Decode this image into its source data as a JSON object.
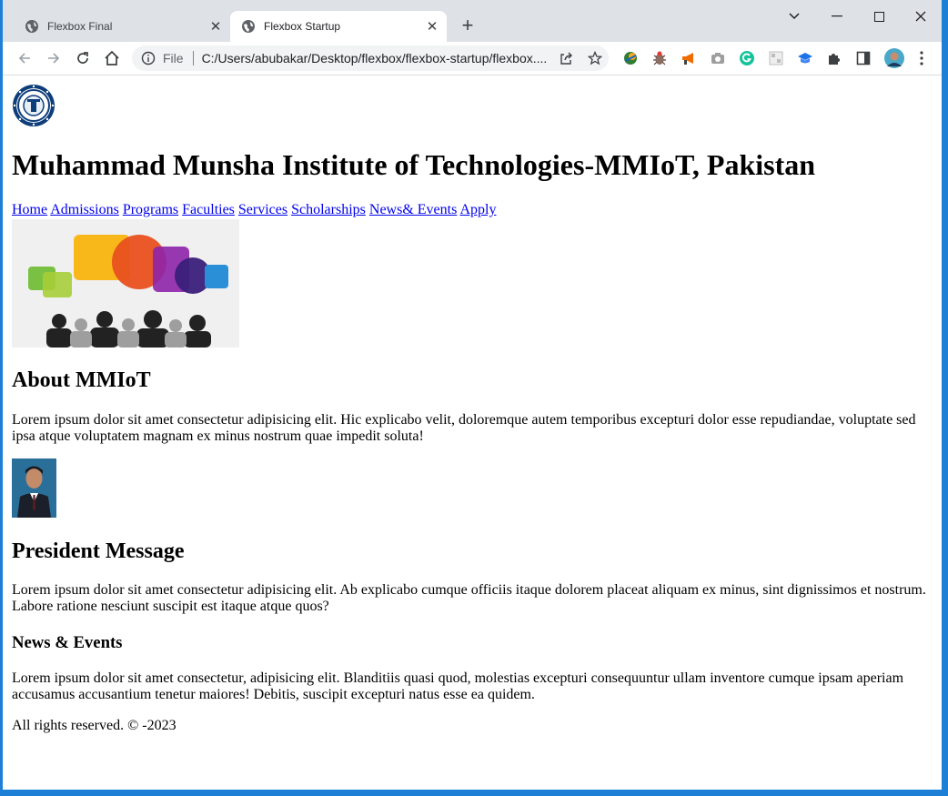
{
  "browser": {
    "tabs": [
      {
        "title": "Flexbox Final",
        "active": false
      },
      {
        "title": "Flexbox Startup",
        "active": true
      }
    ],
    "omnibox": {
      "scheme_label": "File",
      "url": "C:/Users/abubakar/Desktop/flexbox/flexbox-startup/flexbox...."
    },
    "icons": [
      "back-icon",
      "forward-icon",
      "reload-icon",
      "home-icon",
      "info-icon",
      "share-icon",
      "star-icon",
      "extensions-icon",
      "side-panel-icon",
      "profile-avatar",
      "menu-icon",
      "minimize-icon",
      "maximize-icon",
      "close-icon",
      "new-tab-icon",
      "tab-search-icon"
    ]
  },
  "page": {
    "title": "Muhammad Munsha Institute of Technologies-MMIoT, Pakistan",
    "nav": [
      "Home",
      "Admissions",
      "Programs",
      "Faculties",
      "Services",
      "Scholarships",
      "News& Events",
      "Apply"
    ],
    "about": {
      "heading": "About MMIoT",
      "text": "Lorem ipsum dolor sit amet consectetur adipisicing elit. Hic explicabo velit, doloremque autem temporibus excepturi dolor esse repudiandae, voluptate sed ipsa atque voluptatem magnam ex minus nostrum quae impedit soluta!"
    },
    "president": {
      "heading": "President Message",
      "text": "Lorem ipsum dolor sit amet consectetur adipisicing elit. Ab explicabo cumque officiis itaque dolorem placeat aliquam ex minus, sint dignissimos et nostrum. Labore ratione nesciunt suscipit est itaque atque quos?"
    },
    "news": {
      "heading": "News & Events",
      "text": "Lorem ipsum dolor sit amet consectetur, adipisicing elit. Blanditiis quasi quod, molestias excepturi consequuntur ullam inventore cumque ipsam aperiam accusamus accusantium tenetur maiores! Debitis, suscipit excepturi natus esse ea quidem."
    },
    "footer": "All rights reserved. © -2023"
  },
  "colors": {
    "link": "#0000ee",
    "tabstrip": "#dee1e6",
    "desktop": "#1e7fd6"
  }
}
